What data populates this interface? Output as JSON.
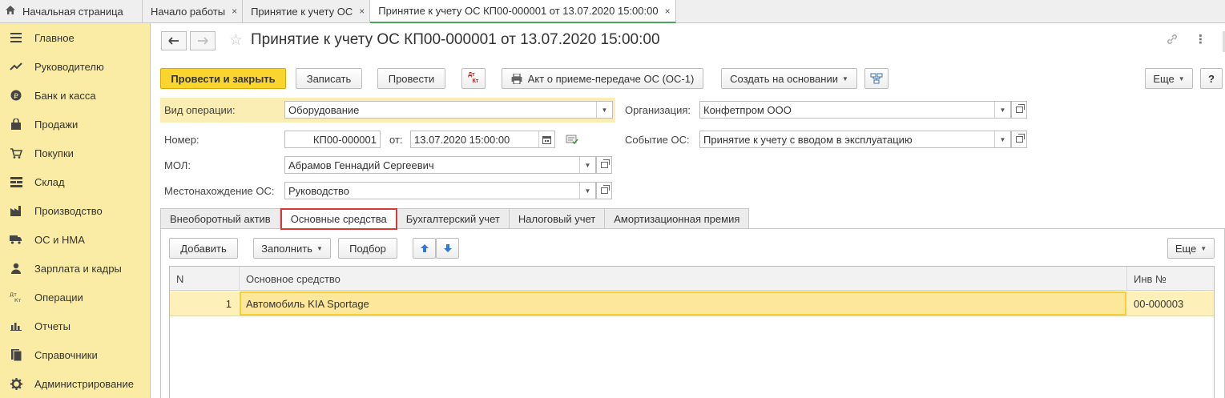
{
  "top_tabs": {
    "home": "Начальная страница",
    "items": [
      {
        "label": "Начало работы",
        "close": "×"
      },
      {
        "label": "Принятие к учету ОС",
        "close": "×"
      },
      {
        "label": "Принятие к учету ОС КП00-000001 от 13.07.2020 15:00:00",
        "close": "×"
      }
    ]
  },
  "sidebar": {
    "items": [
      {
        "label": "Главное",
        "icon": "menu-icon"
      },
      {
        "label": "Руководителю",
        "icon": "trend-icon"
      },
      {
        "label": "Банк и касса",
        "icon": "ruble-icon"
      },
      {
        "label": "Продажи",
        "icon": "bag-icon"
      },
      {
        "label": "Покупки",
        "icon": "cart-icon"
      },
      {
        "label": "Склад",
        "icon": "warehouse-icon"
      },
      {
        "label": "Производство",
        "icon": "factory-icon"
      },
      {
        "label": "ОС и НМА",
        "icon": "truck-icon"
      },
      {
        "label": "Зарплата и кадры",
        "icon": "person-icon"
      },
      {
        "label": "Операции",
        "icon": "dt-kt-icon"
      },
      {
        "label": "Отчеты",
        "icon": "bar-chart-icon"
      },
      {
        "label": "Справочники",
        "icon": "book-icon"
      },
      {
        "label": "Администрирование",
        "icon": "gear-icon"
      }
    ]
  },
  "header": {
    "title": "Принятие к учету ОС КП00-000001 от 13.07.2020 15:00:00"
  },
  "toolbar": {
    "post_close": "Провести и закрыть",
    "save": "Записать",
    "post": "Провести",
    "dtkt_top": "Дт",
    "dtkt_bottom": "Кт",
    "print": "Акт о приеме-передаче ОС (ОС-1)",
    "create_based": "Создать на основании",
    "more": "Еще",
    "help": "?"
  },
  "form": {
    "operation_label": "Вид операции:",
    "operation_value": "Оборудование",
    "org_label": "Организация:",
    "org_value": "Конфетпром ООО",
    "number_label": "Номер:",
    "number_value": "КП00-000001",
    "date_label": "от:",
    "date_value": "13.07.2020 15:00:00",
    "event_label": "Событие ОС:",
    "event_value": "Принятие к учету с вводом в эксплуатацию",
    "mol_label": "МОЛ:",
    "mol_value": "Абрамов Геннадий Сергеевич",
    "location_label": "Местонахождение ОС:",
    "location_value": "Руководство"
  },
  "tabs": [
    {
      "label": "Внеоборотный актив",
      "active": false
    },
    {
      "label": "Основные средства",
      "active": true
    },
    {
      "label": "Бухгалтерский учет",
      "active": false
    },
    {
      "label": "Налоговый учет",
      "active": false
    },
    {
      "label": "Амортизационная премия",
      "active": false
    }
  ],
  "table_toolbar": {
    "add": "Добавить",
    "fill": "Заполнить",
    "select": "Подбор",
    "more": "Еще"
  },
  "table": {
    "columns": [
      "N",
      "Основное средство",
      "Инв №"
    ],
    "rows": [
      {
        "n": "1",
        "asset": "Автомобиль KIA Sportage",
        "inv": "00-000003"
      }
    ]
  },
  "colors": {
    "sidebar_bg": "#fbeca5",
    "primary_button": "#fad52e",
    "active_tab_border": "#d13b3b",
    "selected_row": "#fdf0b8"
  }
}
